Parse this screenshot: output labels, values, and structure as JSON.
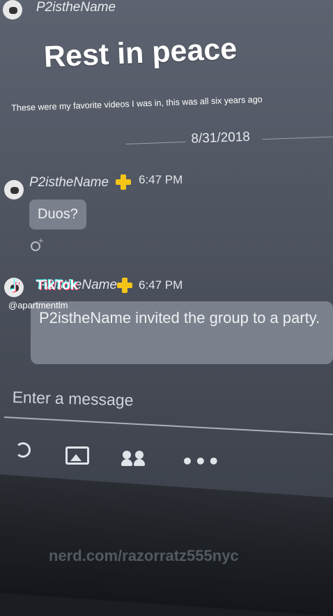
{
  "header": {
    "username": "P2istheName"
  },
  "overlay": {
    "title": "Rest in peace",
    "caption": "These were my favorite videos I was in, this was all six years ago"
  },
  "chat": {
    "date_separator": "8/31/2018",
    "messages": [
      {
        "sender": "P2istheName",
        "time": "6:47 PM",
        "text": "Duos?"
      },
      {
        "sender": "P2istheName",
        "time": "6:47 PM",
        "text": "P2istheName invited the group to a party."
      }
    ]
  },
  "tiktok": {
    "brand": "TikTok",
    "handle": "@apartmentlm"
  },
  "composer": {
    "placeholder": "Enter a message"
  },
  "toolbar": {
    "icons": [
      "refresh-icon",
      "image-icon",
      "group-icon",
      "more-icon"
    ],
    "more_label": "•••"
  },
  "watermark": "nerd.com/razorratz555nyc",
  "colors": {
    "plus_badge": "#f4c518",
    "bubble": "#7b818c"
  }
}
